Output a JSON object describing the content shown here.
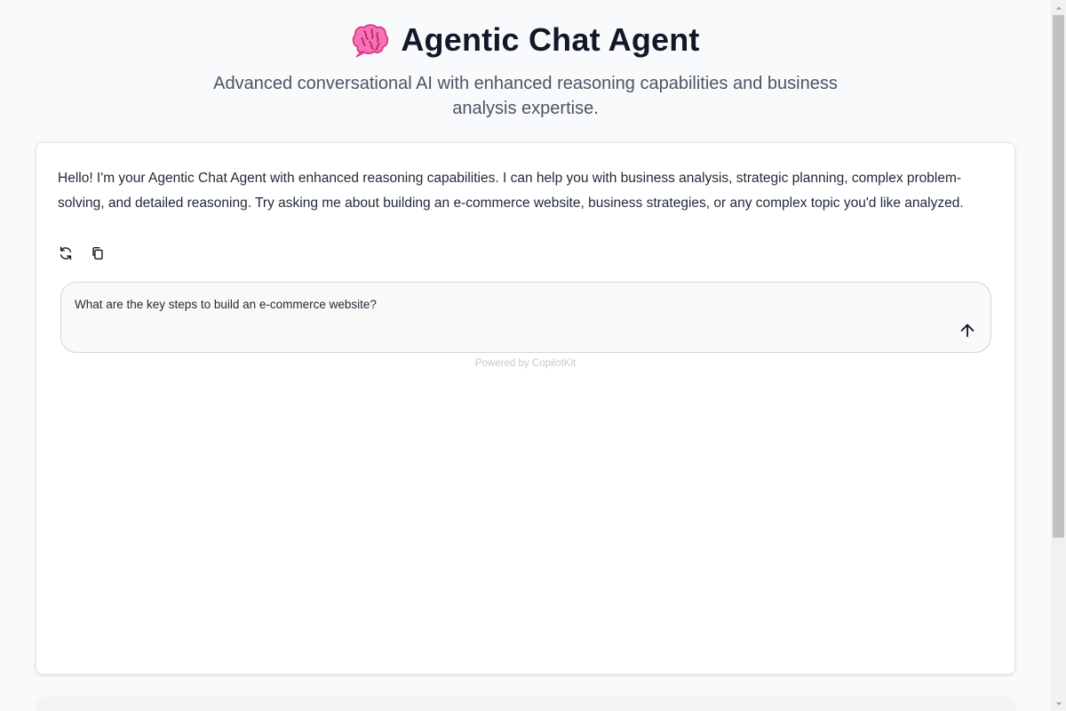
{
  "header": {
    "icon": "brain-icon",
    "title": "Agentic Chat Agent",
    "subtitle": "Advanced conversational AI with enhanced reasoning capabilities and business analysis expertise."
  },
  "chat": {
    "assistant_message": "Hello! I'm your Agentic Chat Agent with enhanced reasoning capabilities. I can help you with business analysis, strategic planning, complex problem-solving, and detailed reasoning. Try asking me about building an e-commerce website, business strategies, or any complex topic you'd like analyzed.",
    "actions": [
      {
        "icon": "regenerate-icon"
      },
      {
        "icon": "copy-icon"
      }
    ],
    "input": {
      "value": "What are the key steps to build an e-commerce website?"
    },
    "send_icon": "arrow-up-icon",
    "powered_by": "Powered by CopilotKit"
  },
  "colors": {
    "background": "#f9fafb",
    "card": "#ffffff",
    "title": "#111827",
    "subtitle": "#4b5563",
    "brain": "#ec4899"
  }
}
